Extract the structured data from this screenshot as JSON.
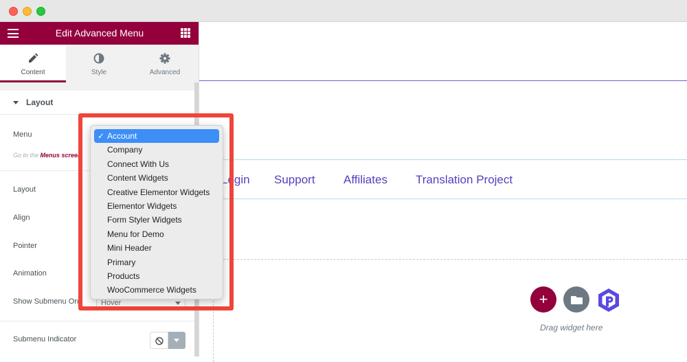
{
  "panel": {
    "title": "Edit Advanced Menu",
    "tabs": [
      {
        "label": "Content",
        "icon": "pencil-icon"
      },
      {
        "label": "Style",
        "icon": "contrast-icon"
      },
      {
        "label": "Advanced",
        "icon": "gear-icon"
      }
    ],
    "section_title": "Layout",
    "controls": {
      "menu_label": "Menu",
      "hint_prefix": "Go to the ",
      "hint_link": "Menus screen",
      "layout_label": "Layout",
      "align_label": "Align",
      "pointer_label": "Pointer",
      "animation_label": "Animation",
      "show_submenu_label": "Show Submenu On",
      "show_submenu_value": "Hover",
      "submenu_indicator_label": "Submenu Indicator"
    }
  },
  "menu_dropdown": {
    "selected": "Account",
    "options": [
      "Account",
      "Company",
      "Connect With Us",
      "Content Widgets",
      "Creative Elementor Widgets",
      "Elementor Widgets",
      "Form Styler Widgets",
      "Menu for Demo",
      "Mini Header",
      "Primary",
      "Products",
      "WooCommerce Widgets"
    ]
  },
  "canvas": {
    "nav_links": [
      "Login",
      "Support",
      "Affiliates",
      "Translation Project"
    ],
    "add_button": "+",
    "drag_text": "Drag widget here"
  },
  "colors": {
    "brand": "#93003c",
    "nav_link": "#5440c0",
    "highlight": "#f0453a",
    "selected_option": "#3d8ef7"
  }
}
